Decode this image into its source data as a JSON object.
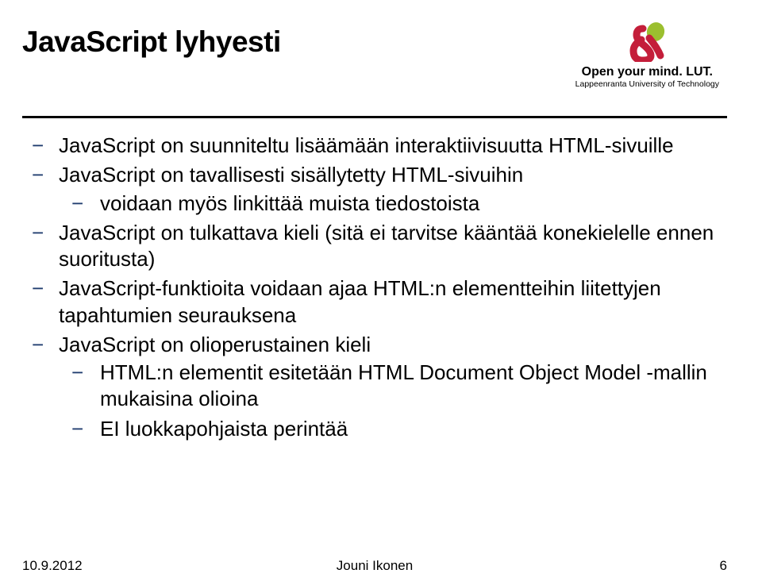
{
  "header": {
    "title": "JavaScript lyhyesti",
    "logo_main": "Open your mind. LUT.",
    "logo_sub": "Lappeenranta University of Technology"
  },
  "bullets": {
    "b1": "JavaScript on suunniteltu lisäämään interaktiivisuutta HTML-sivuille",
    "b2": "JavaScript on tavallisesti sisällytetty HTML-sivuihin",
    "b2_1": "voidaan myös linkittää muista tiedostoista",
    "b3": "JavaScript on tulkattava kieli (sitä ei tarvitse kääntää konekielelle ennen suoritusta)",
    "b4": "JavaScript-funktioita voidaan ajaa HTML:n elementteihin liitettyjen tapahtumien seurauksena",
    "b5": "JavaScript on olioperustainen kieli",
    "b5_1": "HTML:n elementit esitetään HTML Document Object Model -mallin mukaisina olioina",
    "b5_2": "EI luokkapohjaista perintää"
  },
  "footer": {
    "date": "10.9.2012",
    "author": "Jouni Ikonen",
    "page": "6"
  }
}
